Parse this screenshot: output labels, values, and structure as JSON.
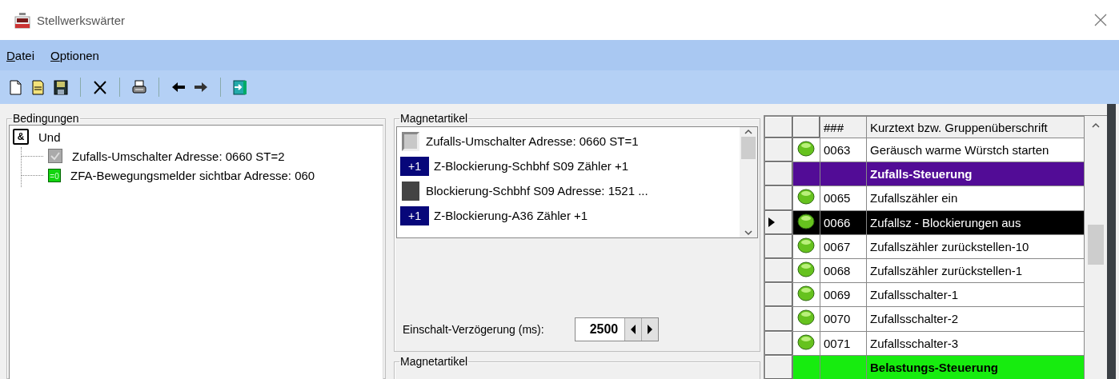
{
  "window": {
    "title": "Stellwerkswärter"
  },
  "menu": [
    "Datei",
    "Optionen"
  ],
  "toolbar": [
    {
      "kind": "new"
    },
    {
      "kind": "open"
    },
    {
      "kind": "save"
    },
    {
      "kind": "sep"
    },
    {
      "kind": "delete"
    },
    {
      "kind": "sep"
    },
    {
      "kind": "print"
    },
    {
      "kind": "sep"
    },
    {
      "kind": "back"
    },
    {
      "kind": "forward"
    },
    {
      "kind": "sep"
    },
    {
      "kind": "exit"
    }
  ],
  "conditions": {
    "label": "Bedingungen",
    "root": {
      "kind": "and",
      "badge": "&",
      "text": "Und",
      "children": [
        {
          "kind": "check",
          "text": "Zufalls-Umschalter Adresse: 0660 ST=2"
        },
        {
          "kind": "sensor",
          "badge": "=0",
          "text": "ZFA-Bewegungsmelder sichtbar Adresse: 060"
        }
      ]
    }
  },
  "magnet": {
    "label": "Magnetartikel",
    "items": [
      {
        "kind": "light",
        "text": "Zufalls-Umschalter Adresse: 0660 ST=1"
      },
      {
        "kind": "counter",
        "badge": "+1",
        "text": "Z-Blockierung-Schbhf S09 Zähler +1"
      },
      {
        "kind": "dark",
        "text": "Blockierung-Schbhf S09 Adresse: 1521 ..."
      },
      {
        "kind": "counter",
        "badge": "+1",
        "text": "Z-Blockierung-A36 Zähler +1"
      }
    ],
    "delay_label": "Einschalt-Verzögerung (ms):",
    "delay_value": "2500"
  },
  "magnet2": {
    "label": "Magnetartikel"
  },
  "grid": {
    "columns": [
      "###",
      "Kurztext bzw. Gruppenüberschrift"
    ],
    "rows": [
      {
        "kind": "item",
        "number": "0063",
        "text": "Geräusch warme Würstch starten",
        "selected": false
      },
      {
        "kind": "group",
        "text": "Zufalls-Steuerung",
        "color": "#520c96"
      },
      {
        "kind": "item",
        "number": "0065",
        "text": "Zufallszähler ein",
        "selected": false
      },
      {
        "kind": "item",
        "number": "0066",
        "text": "Zufallsz - Blockierungen aus",
        "selected": true
      },
      {
        "kind": "item",
        "number": "0067",
        "text": "Zufallszähler zurückstellen-10",
        "selected": false
      },
      {
        "kind": "item",
        "number": "0068",
        "text": "Zufallszähler zurückstellen-1",
        "selected": false
      },
      {
        "kind": "item",
        "number": "0069",
        "text": "Zufallsschalter-1",
        "selected": false
      },
      {
        "kind": "item",
        "number": "0070",
        "text": "Zufallsschalter-2",
        "selected": false
      },
      {
        "kind": "item",
        "number": "0071",
        "text": "Zufallsschalter-3",
        "selected": false
      },
      {
        "kind": "group",
        "text": "Belastungs-Steuerung",
        "color": "#17ec0f"
      }
    ]
  }
}
